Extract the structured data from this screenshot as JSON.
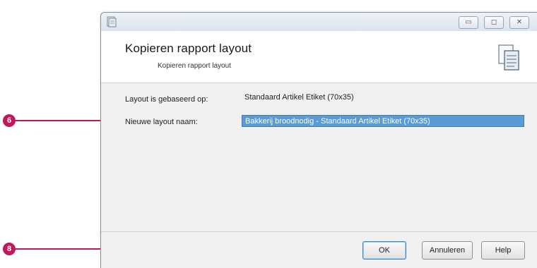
{
  "dialog": {
    "title": "Kopieren rapport layout",
    "subtitle": "Kopieren rapport layout",
    "titlebar_controls": {
      "minimize": "▭",
      "maximize": "◻",
      "close": "✕"
    }
  },
  "form": {
    "based_on_label": "Layout is gebaseerd op:",
    "based_on_value": "Standaard Artikel Etiket (70x35)",
    "new_name_label": "Nieuwe layout naam:",
    "new_name_value": "Bakkerij broodnodig - Standaard Artikel Etiket (70x35)"
  },
  "buttons": {
    "ok": "OK",
    "cancel": "Annuleren",
    "help": "Help"
  },
  "callouts": [
    "6",
    "8"
  ],
  "colors": {
    "callout": "#c2185b",
    "selection": "#5a9bd5"
  },
  "icons": [
    "app-icon",
    "copy-document-icon"
  ]
}
